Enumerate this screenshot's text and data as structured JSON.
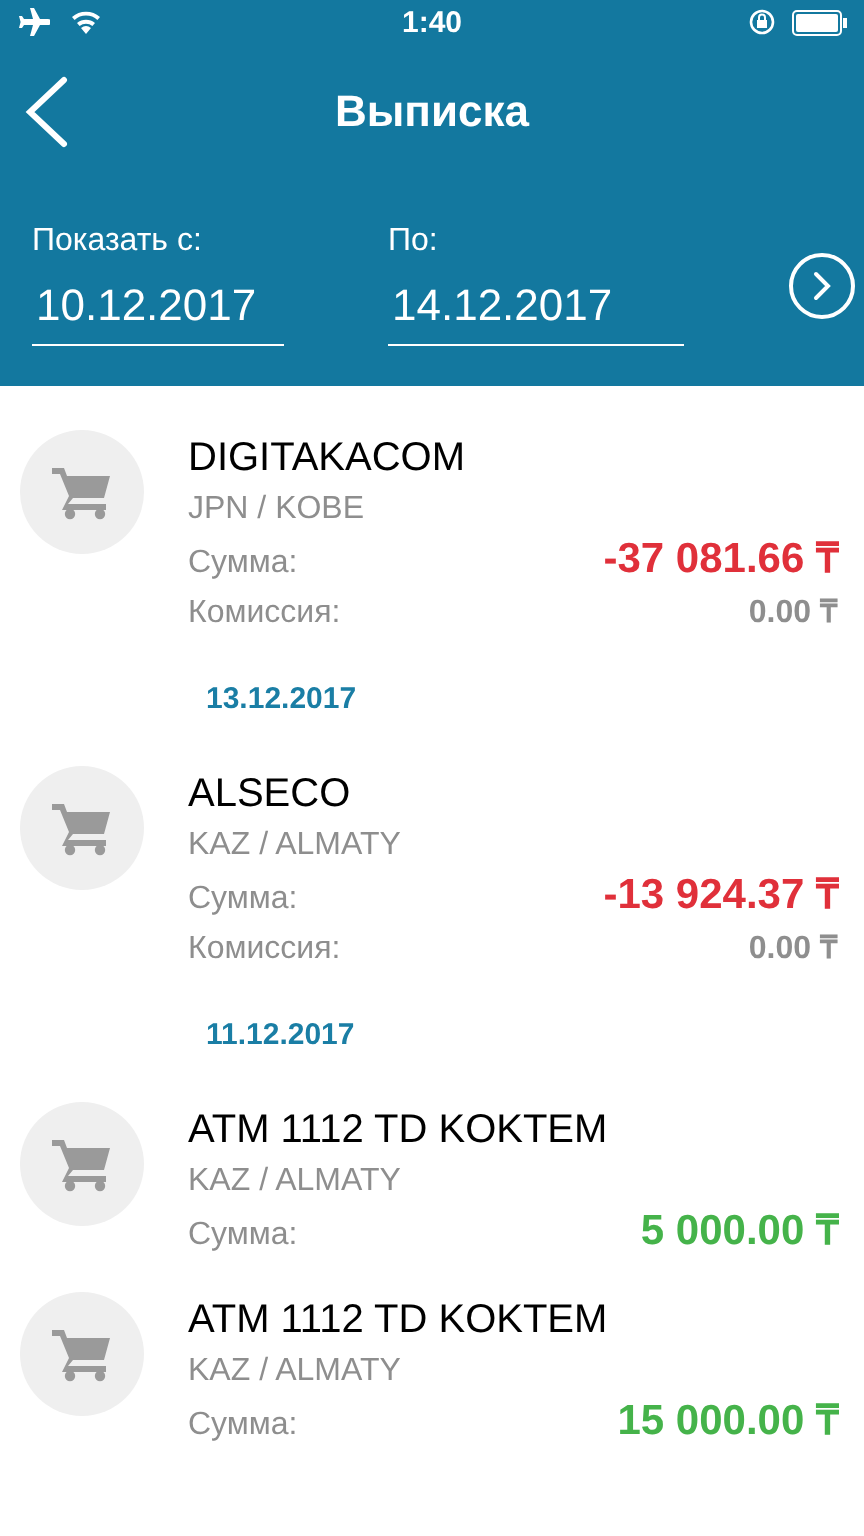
{
  "status_bar": {
    "time": "1:40"
  },
  "header": {
    "title": "Выписка"
  },
  "period": {
    "from_label": "Показать с:",
    "from_value": "10.12.2017",
    "to_label": "По:",
    "to_value": "14.12.2017"
  },
  "entries": [
    {
      "kind": "transaction",
      "merchant": "DIGITAKACOM",
      "location": "JPN / KOBE",
      "amount_label": "Сумма:",
      "amount": "-37 081.66 ₸",
      "color": "#e0303a",
      "fee_label": "Комиссия:",
      "fee": "0.00 ₸"
    },
    {
      "kind": "date",
      "date": "13.12.2017"
    },
    {
      "kind": "transaction",
      "merchant": "ALSECO",
      "location": "KAZ / ALMATY",
      "amount_label": "Сумма:",
      "amount": "-13 924.37 ₸",
      "color": "#e0303a",
      "fee_label": "Комиссия:",
      "fee": "0.00 ₸"
    },
    {
      "kind": "date",
      "date": "11.12.2017"
    },
    {
      "kind": "transaction",
      "merchant": "ATM 1112 TD KOKTEM",
      "location": "KAZ / ALMATY",
      "amount_label": "Сумма:",
      "amount": "5 000.00 ₸",
      "color": "#45b34a"
    },
    {
      "kind": "transaction",
      "merchant": "ATM 1112 TD KOKTEM",
      "location": "KAZ / ALMATY",
      "amount_label": "Сумма:",
      "amount": "15 000.00 ₸",
      "color": "#45b34a"
    }
  ]
}
